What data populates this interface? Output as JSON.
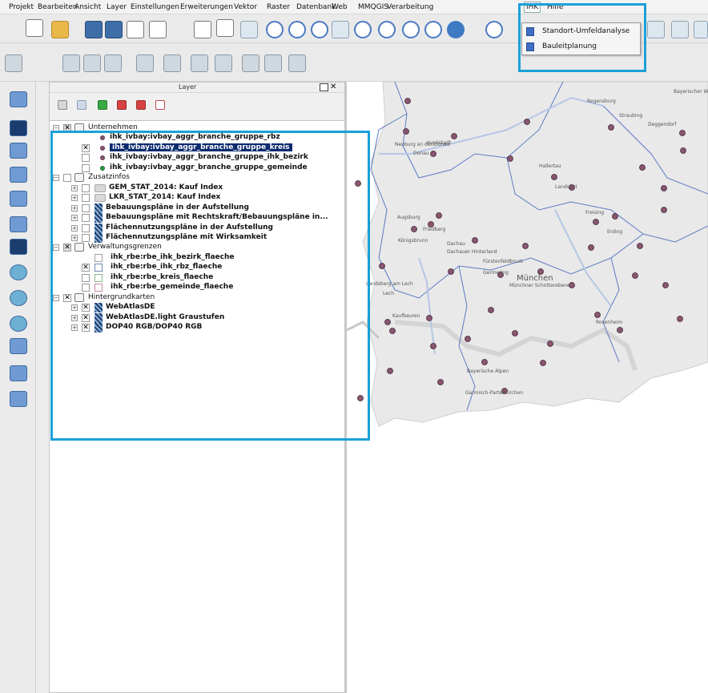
{
  "menubar": {
    "items": [
      "Projekt",
      "Bearbeiten",
      "Ansicht",
      "Layer",
      "Einstellungen",
      "Erweiterungen",
      "Vektor",
      "Raster",
      "Datenbank",
      "Web",
      "MMQGIS",
      "Verarbeitung",
      "IHK",
      "Hilfe"
    ],
    "active": "IHK"
  },
  "ihk_menu": {
    "items": [
      {
        "label": "Standort-Umfeldanalyse",
        "icon": "location-icon"
      },
      {
        "label": "Bauleitplanung",
        "icon": "plan-icon"
      }
    ]
  },
  "layer_panel": {
    "title": "Layer",
    "tree": [
      {
        "label": "Unternehmen",
        "kind": "group",
        "checked": "grey",
        "level": 0
      },
      {
        "label": "ihk_ivbay:ivbay_aggr_branche_gruppe_rbz",
        "kind": "layer",
        "symbol": "dot-purple",
        "checked": "none",
        "level": 1
      },
      {
        "label": "ihk_ivbay:ivbay_aggr_branche_gruppe_kreis",
        "kind": "layer",
        "symbol": "dot-purple",
        "checked": "x",
        "level": 1,
        "selected": true
      },
      {
        "label": "ihk_ivbay:ivbay_aggr_branche_gruppe_ihk_bezirk",
        "kind": "layer",
        "symbol": "dot-purple",
        "checked": "empty",
        "level": 1
      },
      {
        "label": "ihk_ivbay:ivbay_aggr_branche_gruppe_gemeinde",
        "kind": "layer",
        "symbol": "dot-green",
        "checked": "empty",
        "level": 1
      },
      {
        "label": "Zusatzinfos",
        "kind": "group",
        "checked": "empty",
        "level": 0
      },
      {
        "label": "GEM_STAT_2014: Kauf Index",
        "kind": "layer",
        "symbol": "raster",
        "checked": "empty",
        "level": 1,
        "expandable": true
      },
      {
        "label": "LKR_STAT_2014: Kauf Index",
        "kind": "layer",
        "symbol": "raster",
        "checked": "empty",
        "level": 1,
        "expandable": true
      },
      {
        "label": "Bebauungspläne in der Aufstellung",
        "kind": "layer",
        "symbol": "pattern",
        "checked": "empty",
        "level": 1,
        "expandable": true
      },
      {
        "label": "Bebauungspläne mit Rechtskraft/Bebauungspläne in...",
        "kind": "layer",
        "symbol": "pattern",
        "checked": "empty",
        "level": 1,
        "expandable": true
      },
      {
        "label": "Flächennutzungspläne in der Aufstellung",
        "kind": "layer",
        "symbol": "pattern",
        "checked": "empty",
        "level": 1,
        "expandable": true
      },
      {
        "label": "Flächennutzungspläne mit Wirksamkeit",
        "kind": "layer",
        "symbol": "pattern",
        "checked": "empty",
        "level": 1,
        "expandable": true
      },
      {
        "label": "Verwaltungsgrenzen",
        "kind": "group",
        "checked": "grey",
        "level": 0
      },
      {
        "label": "ihk_rbe:rbe_ihk_bezirk_flaeche",
        "kind": "layer",
        "symbol": "poly-grey",
        "checked": "none",
        "level": 1
      },
      {
        "label": "ihk_rbe:rbe_ihk_rbz_flaeche",
        "kind": "layer",
        "symbol": "poly-blue",
        "checked": "x",
        "level": 1
      },
      {
        "label": "ihk_rbe:rbe_kreis_flaeche",
        "kind": "layer",
        "symbol": "poly-green",
        "checked": "empty",
        "level": 1
      },
      {
        "label": "ihk_rbe:rbe_gemeinde_flaeche",
        "kind": "layer",
        "symbol": "poly-pink",
        "checked": "empty",
        "level": 1
      },
      {
        "label": "Hintergrundkarten",
        "kind": "group",
        "checked": "x",
        "level": 0
      },
      {
        "label": "WebAtlasDE",
        "kind": "layer",
        "symbol": "pattern",
        "checked": "x",
        "level": 1,
        "expandable": true
      },
      {
        "label": "WebAtlasDE.light Graustufen",
        "kind": "layer",
        "symbol": "pattern",
        "checked": "x",
        "level": 1,
        "expandable": true
      },
      {
        "label": "DOP40 RGB/DOP40 RGB",
        "kind": "layer",
        "symbol": "pattern",
        "checked": "x",
        "level": 1,
        "expandable": true
      }
    ]
  },
  "map": {
    "labels": [
      "Regensburg",
      "Straubing",
      "Deggendorf",
      "Bayerischer Wald",
      "Neuburg an der Donau",
      "Ingolstadt",
      "Donau",
      "Hallertau",
      "Landshut",
      "Augsburg",
      "Friedberg",
      "Freising",
      "Erding",
      "Königsbrunn",
      "Dachau",
      "Dachauer Hinterland",
      "Fürstenfeldbruck",
      "Germering",
      "München",
      "Münchner Schotterebene",
      "Landsberg am Lech",
      "Lech",
      "Kaufbeuren",
      "Rosenheim",
      "Bayerische Alpen",
      "Garmisch-Partenkirchen"
    ],
    "symbol_color": "#8a5570"
  }
}
